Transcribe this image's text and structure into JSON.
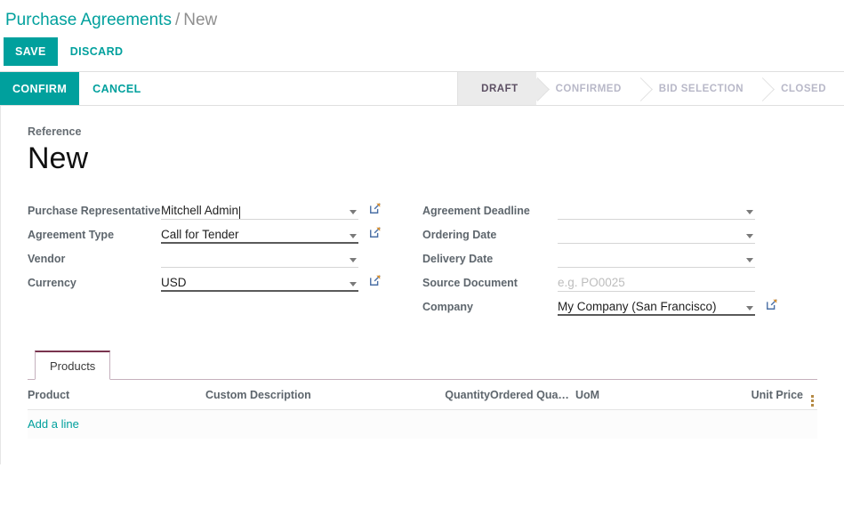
{
  "breadcrumb": {
    "root": "Purchase Agreements",
    "separator": "/",
    "current": "New"
  },
  "toolbar_primary": {
    "save_label": "SAVE",
    "discard_label": "DISCARD"
  },
  "toolbar_secondary": {
    "confirm_label": "CONFIRM",
    "cancel_label": "CANCEL"
  },
  "statusbar": {
    "stages": [
      {
        "label": "DRAFT",
        "active": true
      },
      {
        "label": "CONFIRMED",
        "active": false
      },
      {
        "label": "BID SELECTION",
        "active": false
      },
      {
        "label": "CLOSED",
        "active": false
      }
    ]
  },
  "record": {
    "reference_label": "Reference",
    "reference_value": "New"
  },
  "form": {
    "left": [
      {
        "label": "Purchase Representative",
        "value": "Mitchell Admin",
        "placeholder": "",
        "has_caret": true,
        "has_extlink": true,
        "focused": true,
        "strong_underline": false
      },
      {
        "label": "Agreement Type",
        "value": "Call for Tender",
        "placeholder": "",
        "has_caret": true,
        "has_extlink": true,
        "focused": false,
        "strong_underline": true
      },
      {
        "label": "Vendor",
        "value": "",
        "placeholder": "",
        "has_caret": true,
        "has_extlink": false,
        "focused": false,
        "strong_underline": false
      },
      {
        "label": "Currency",
        "value": "USD",
        "placeholder": "",
        "has_caret": true,
        "has_extlink": true,
        "focused": false,
        "strong_underline": true
      }
    ],
    "right": [
      {
        "label": "Agreement Deadline",
        "value": "",
        "placeholder": "",
        "has_caret": true,
        "has_extlink": false,
        "focused": false,
        "strong_underline": false
      },
      {
        "label": "Ordering Date",
        "value": "",
        "placeholder": "",
        "has_caret": true,
        "has_extlink": false,
        "focused": false,
        "strong_underline": false
      },
      {
        "label": "Delivery Date",
        "value": "",
        "placeholder": "",
        "has_caret": true,
        "has_extlink": false,
        "focused": false,
        "strong_underline": false
      },
      {
        "label": "Source Document",
        "value": "",
        "placeholder": "e.g. PO0025",
        "has_caret": false,
        "has_extlink": false,
        "focused": false,
        "strong_underline": false
      },
      {
        "label": "Company",
        "value": "My Company (San Francisco)",
        "placeholder": "",
        "has_caret": true,
        "has_extlink": true,
        "focused": false,
        "strong_underline": true
      }
    ]
  },
  "notebook": {
    "tabs": [
      {
        "label": "Products",
        "active": true
      }
    ],
    "table": {
      "columns": [
        "Product",
        "Custom Description",
        "Quantity",
        "Ordered Qua…",
        "UoM",
        "Unit Price"
      ],
      "rows": [],
      "add_line_label": "Add a line"
    }
  },
  "colors": {
    "accent": "#00a09d",
    "tab_accent": "#79344e",
    "status_active_bg": "#ebebeb",
    "status_active_text": "#5c4f63",
    "label_text": "#5e666d"
  }
}
